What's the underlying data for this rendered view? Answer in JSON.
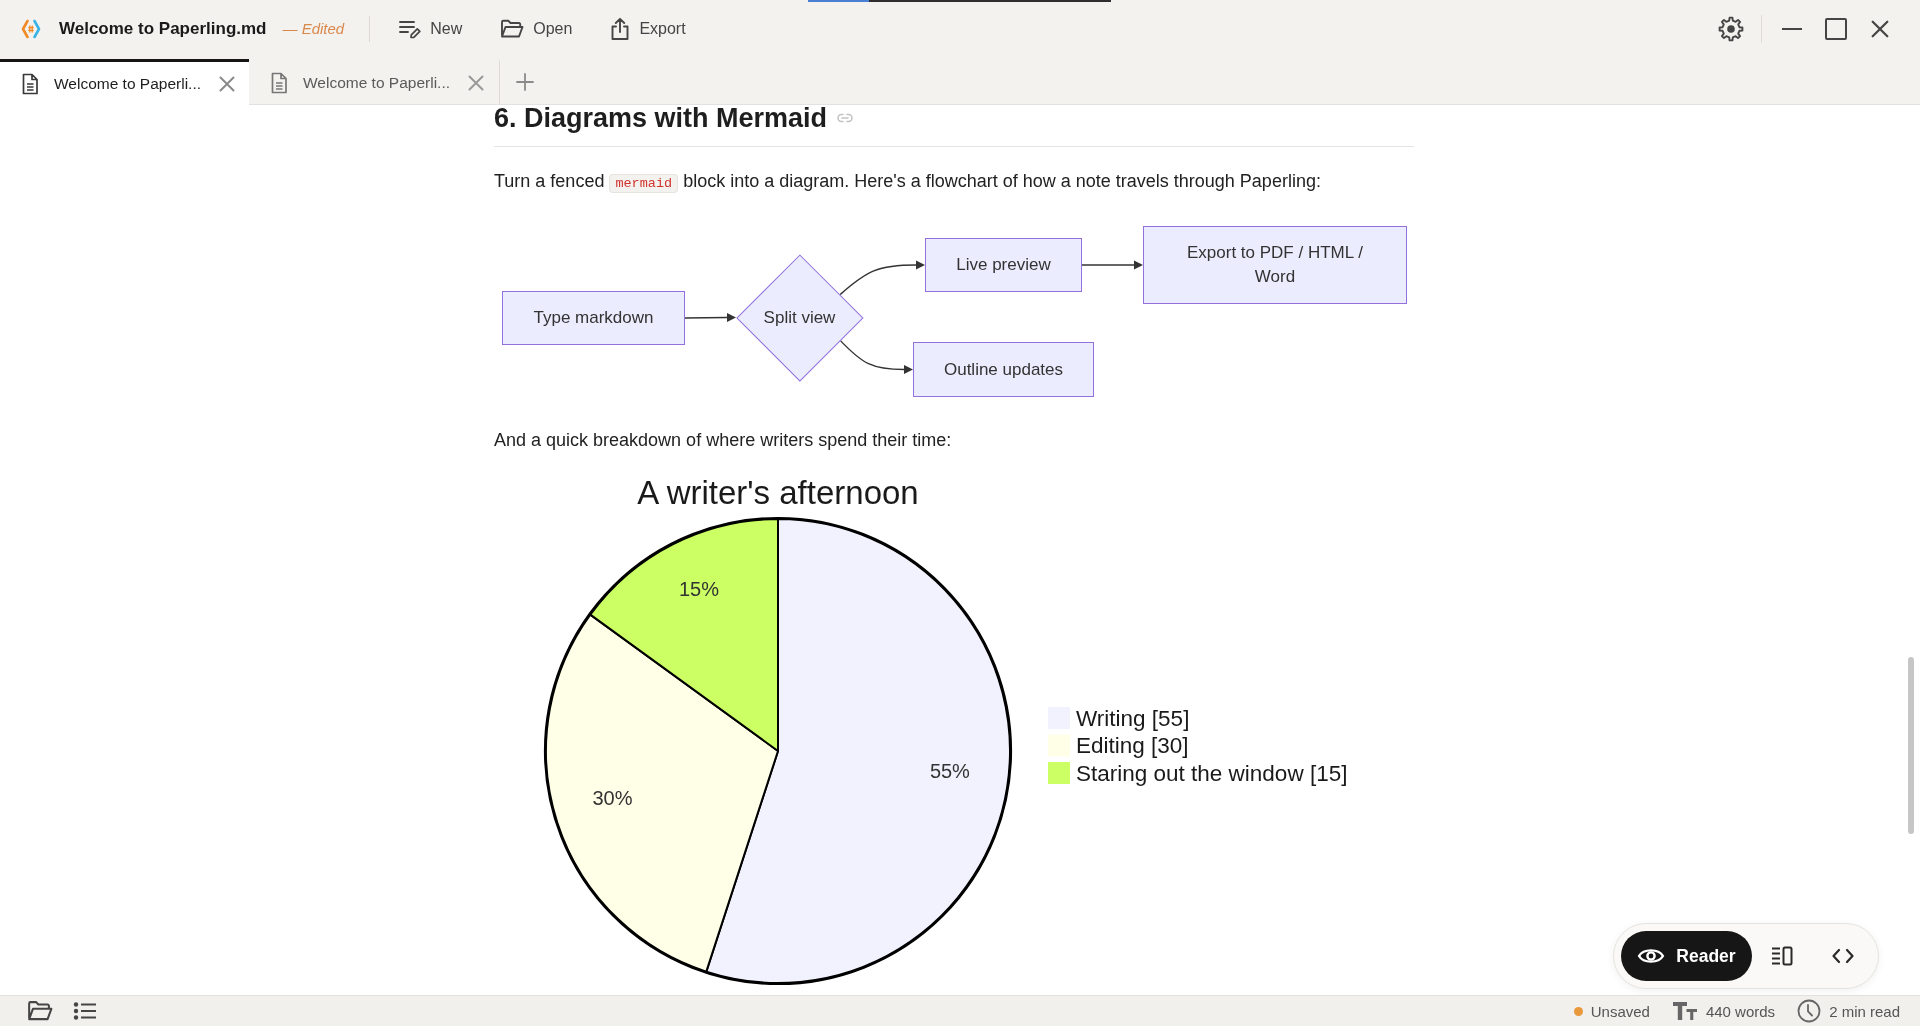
{
  "window": {
    "title": "Welcome to Paperling.md",
    "edited_label": "— Edited",
    "toolbar": [
      {
        "label": "New",
        "kind": "new"
      },
      {
        "label": "Open",
        "kind": "open"
      },
      {
        "label": "Export",
        "kind": "export"
      }
    ]
  },
  "tabs": [
    {
      "label": "Welcome to Paperli...",
      "selected": true
    },
    {
      "label": "Welcome to Paperli...",
      "selected": false
    }
  ],
  "document": {
    "heading": "6. Diagrams with Mermaid",
    "intro": [
      {
        "text": "Turn a fenced ",
        "kind": "plain"
      },
      {
        "text": "mermaid",
        "kind": "code"
      },
      {
        "text": " block into a diagram. Here's a flowchart of how a note travels through Paperling:",
        "kind": "plain"
      }
    ],
    "flowchart": {
      "nodes": [
        {
          "label": "Type markdown",
          "kind": "rect",
          "children": [
            {
              "label": "Split view",
              "kind": "diamond",
              "children": [
                {
                  "label": "Live preview",
                  "kind": "rect",
                  "children": [
                    {
                      "label": "Export to PDF / HTML / Word",
                      "kind": "rect"
                    }
                  ]
                },
                {
                  "label": "Outline updates",
                  "kind": "rect"
                }
              ]
            }
          ]
        }
      ]
    },
    "lead_in": "And a quick breakdown of where writers spend their time:",
    "chart_data": [
      {
        "type": "pie",
        "title": "A writer's afternoon",
        "categories": [
          "Writing [55]",
          "Editing [30]",
          "Staring out the window [15]"
        ],
        "values": [
          55,
          30,
          15
        ],
        "colors": [
          "#f2f2ff",
          "#ffffe8",
          "#cbff63"
        ],
        "value_labels": [
          "55%",
          "30%",
          "15%"
        ],
        "legend": "right"
      }
    ]
  },
  "view_modes": [
    {
      "kind": "reader",
      "label": "Reader",
      "selected": true
    },
    {
      "kind": "split",
      "selected": false
    },
    {
      "kind": "source",
      "selected": false
    }
  ],
  "status_bar": {
    "save_state": {
      "label": "Unsaved",
      "dirty": true
    },
    "word_count": "440 words",
    "read_time": "2 min read"
  }
}
